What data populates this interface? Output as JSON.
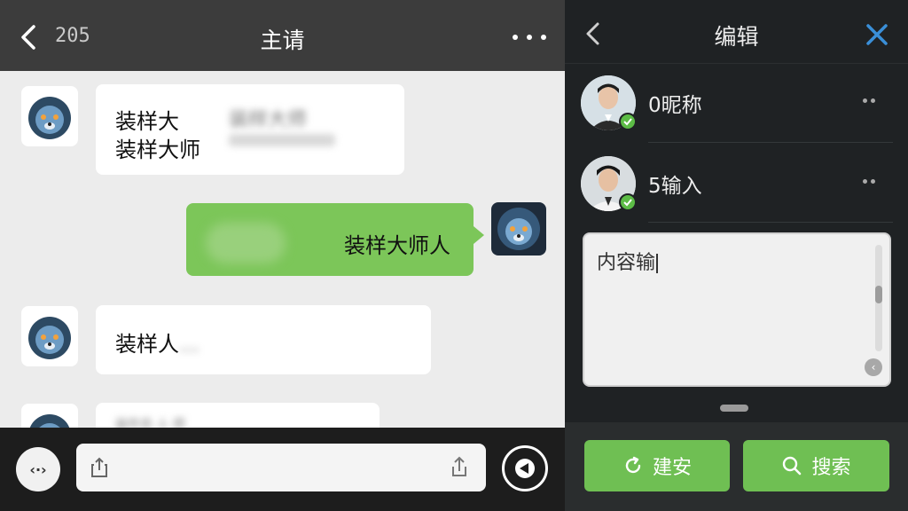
{
  "chat": {
    "unread_count": "205",
    "title": "主请",
    "messages": [
      {
        "side": "left",
        "lines": [
          "装样大",
          "装样大师"
        ],
        "blurred": "装样大师"
      },
      {
        "side": "right",
        "text": "装样大师人"
      },
      {
        "side": "left",
        "text": "装样人",
        "blurred": "..."
      },
      {
        "side": "left",
        "text": "装件衣 人 师"
      }
    ]
  },
  "panel": {
    "title": "编辑",
    "contacts": [
      {
        "name": "0昵称"
      },
      {
        "name": "5输入"
      }
    ],
    "content_text": "内容输",
    "buttons": {
      "left": "建安",
      "right": "搜索"
    }
  },
  "colors": {
    "accent_green": "#6fbf53",
    "my_bubble": "#7cc659",
    "close_blue": "#3a8fd8",
    "verified_green": "#5cbc46"
  },
  "icons": [
    "back-icon",
    "more-icon",
    "voice-icon",
    "attach-icon",
    "upload-icon",
    "send-icon",
    "close-icon",
    "check-icon",
    "refresh-icon",
    "search-icon",
    "lion-avatar"
  ]
}
